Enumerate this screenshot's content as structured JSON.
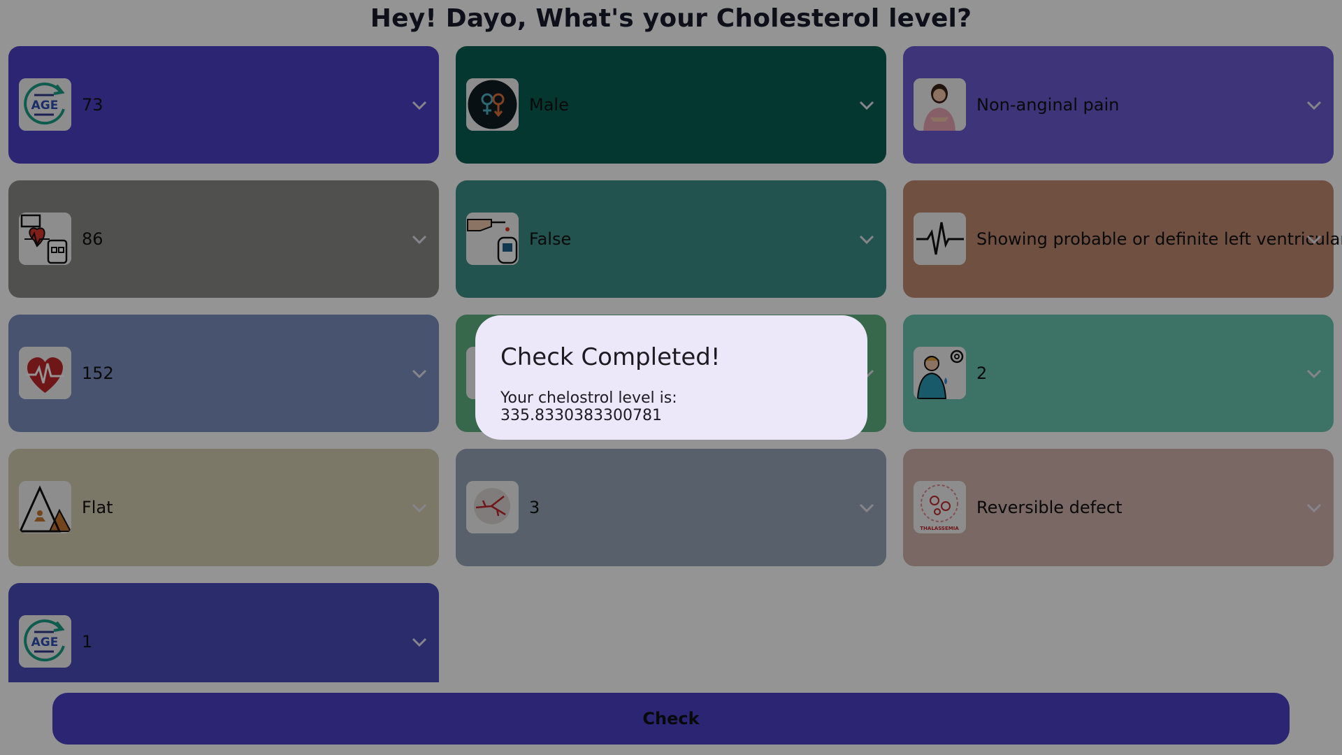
{
  "page": {
    "title": "Hey! Dayo, What's your Cholesterol level?"
  },
  "colors": {
    "age": "#4b40c9",
    "sex": "#0a5f55",
    "chest_pain": "#6a5bd0",
    "resting_bp": "#8a8c89",
    "fasting_sugar": "#3c8f87",
    "ecg": "#c18a6e",
    "max_heart_rate": "#7c90c2",
    "exercise_angina": "#5fb383",
    "oldpeak": "#6ac4b0",
    "slope": "#d6cfb1",
    "vessels": "#96a5b8",
    "thal": "#d0b4ac",
    "target": "#4a4cb8",
    "check_button": "#4b40c9",
    "dialog": "#ece8fa"
  },
  "fields": {
    "age": {
      "value": "73",
      "icon": "age-icon"
    },
    "sex": {
      "value": "Male",
      "icon": "gender-icon"
    },
    "chest_pain": {
      "value": "Non-anginal pain",
      "icon": "chest-pain-woman-icon"
    },
    "resting_bp": {
      "value": "86",
      "icon": "blood-pressure-monitor-icon"
    },
    "fasting_sugar": {
      "value": "False",
      "icon": "glucose-meter-icon"
    },
    "ecg": {
      "value": "Showing probable or definite left ventricular",
      "icon": "ecg-wave-icon"
    },
    "max_heart_rate": {
      "value": "152",
      "icon": "heart-pulse-icon"
    },
    "exercise_angina": {
      "value": "",
      "icon": ""
    },
    "oldpeak": {
      "value": "2",
      "icon": "stressed-person-icon"
    },
    "slope": {
      "value": "Flat",
      "icon": "mountain-slope-icon"
    },
    "vessels": {
      "value": "3",
      "icon": "blood-vessel-icon"
    },
    "thal": {
      "value": "Reversible defect",
      "icon": "thalassemia-icon"
    },
    "target": {
      "value": "1",
      "icon": "age-icon"
    }
  },
  "thal_icon_caption": "THALASSEMIA",
  "check_button": {
    "label": "Check"
  },
  "dialog": {
    "title": "Check Completed!",
    "message": "Your chelostrol level is: 335.8330383300781"
  }
}
